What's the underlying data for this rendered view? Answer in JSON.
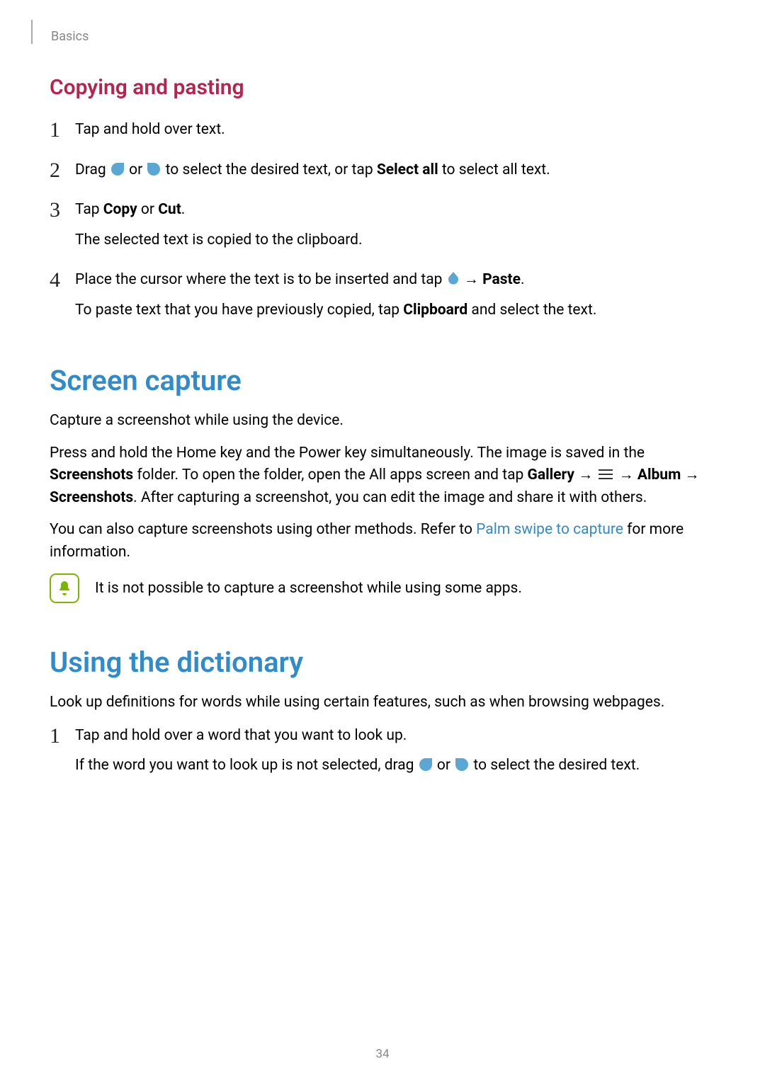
{
  "header": {
    "section": "Basics"
  },
  "copy_paste": {
    "heading": "Copying and pasting",
    "steps": [
      {
        "line1": "Tap and hold over text."
      },
      {
        "pre": "Drag ",
        "mid": " or ",
        "post_a": " to select the desired text, or tap ",
        "bold": "Select all",
        "post_b": " to select all text."
      },
      {
        "pre": "Tap ",
        "b1": "Copy",
        "mid": " or ",
        "b2": "Cut",
        "post": ".",
        "sub": "The selected text is copied to the clipboard."
      },
      {
        "pre": "Place the cursor where the text is to be inserted and tap ",
        "arrow": " → ",
        "b1": "Paste",
        "post": ".",
        "sub_pre": "To paste text that you have previously copied, tap ",
        "sub_b": "Clipboard",
        "sub_post": " and select the text."
      }
    ]
  },
  "screen_capture": {
    "heading": "Screen capture",
    "p1": "Capture a screenshot while using the device.",
    "p2": {
      "a": "Press and hold the Home key and the Power key simultaneously. The image is saved in the ",
      "b1": "Screenshots",
      "b": " folder. To open the folder, open the All apps screen and tap ",
      "b2": "Gallery",
      "arr1": " → ",
      "arr2": " → ",
      "b3": "Album",
      "arr3": " → ",
      "b4": "Screenshots",
      "c": ". After capturing a screenshot, you can edit the image and share it with others."
    },
    "p3": {
      "a": "You can also capture screenshots using other methods. Refer to ",
      "link": "Palm swipe to capture",
      "b": " for more information."
    },
    "note": "It is not possible to capture a screenshot while using some apps."
  },
  "dictionary": {
    "heading": "Using the dictionary",
    "p1": "Look up definitions for words while using certain features, such as when browsing webpages.",
    "steps": [
      {
        "line1": "Tap and hold over a word that you want to look up.",
        "sub_pre": "If the word you want to look up is not selected, drag ",
        "sub_mid": " or ",
        "sub_post": " to select the desired text."
      }
    ]
  },
  "page_number": "34"
}
